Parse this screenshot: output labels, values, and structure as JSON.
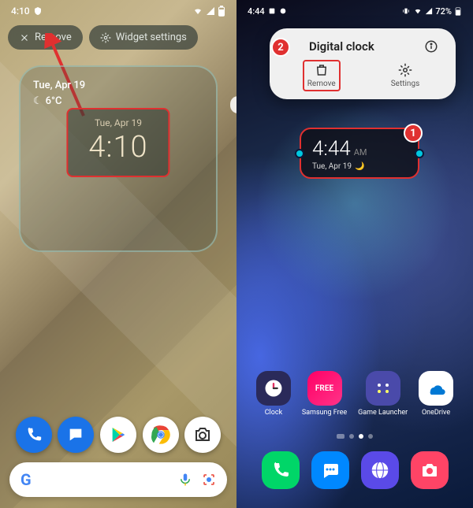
{
  "left": {
    "statusbar": {
      "time": "4:10"
    },
    "pills": {
      "remove": "Remove",
      "settings": "Widget settings"
    },
    "weather": {
      "date": "Tue, Apr 19",
      "temp": "6°C"
    },
    "clock": {
      "date": "Tue, Apr 19",
      "time": "4:10"
    }
  },
  "right": {
    "statusbar": {
      "time": "4:44",
      "battery": "72%"
    },
    "popup": {
      "title": "Digital clock",
      "remove": "Remove",
      "settings": "Settings"
    },
    "widget": {
      "time": "4:44",
      "ampm": "AM",
      "date": "Tue, Apr 19"
    },
    "apps": {
      "clock": "Clock",
      "free": "Samsung Free",
      "free_logo": "FREE",
      "game": "Game Launcher",
      "onedrive": "OneDrive"
    },
    "badges": {
      "one": "1",
      "two": "2"
    }
  }
}
